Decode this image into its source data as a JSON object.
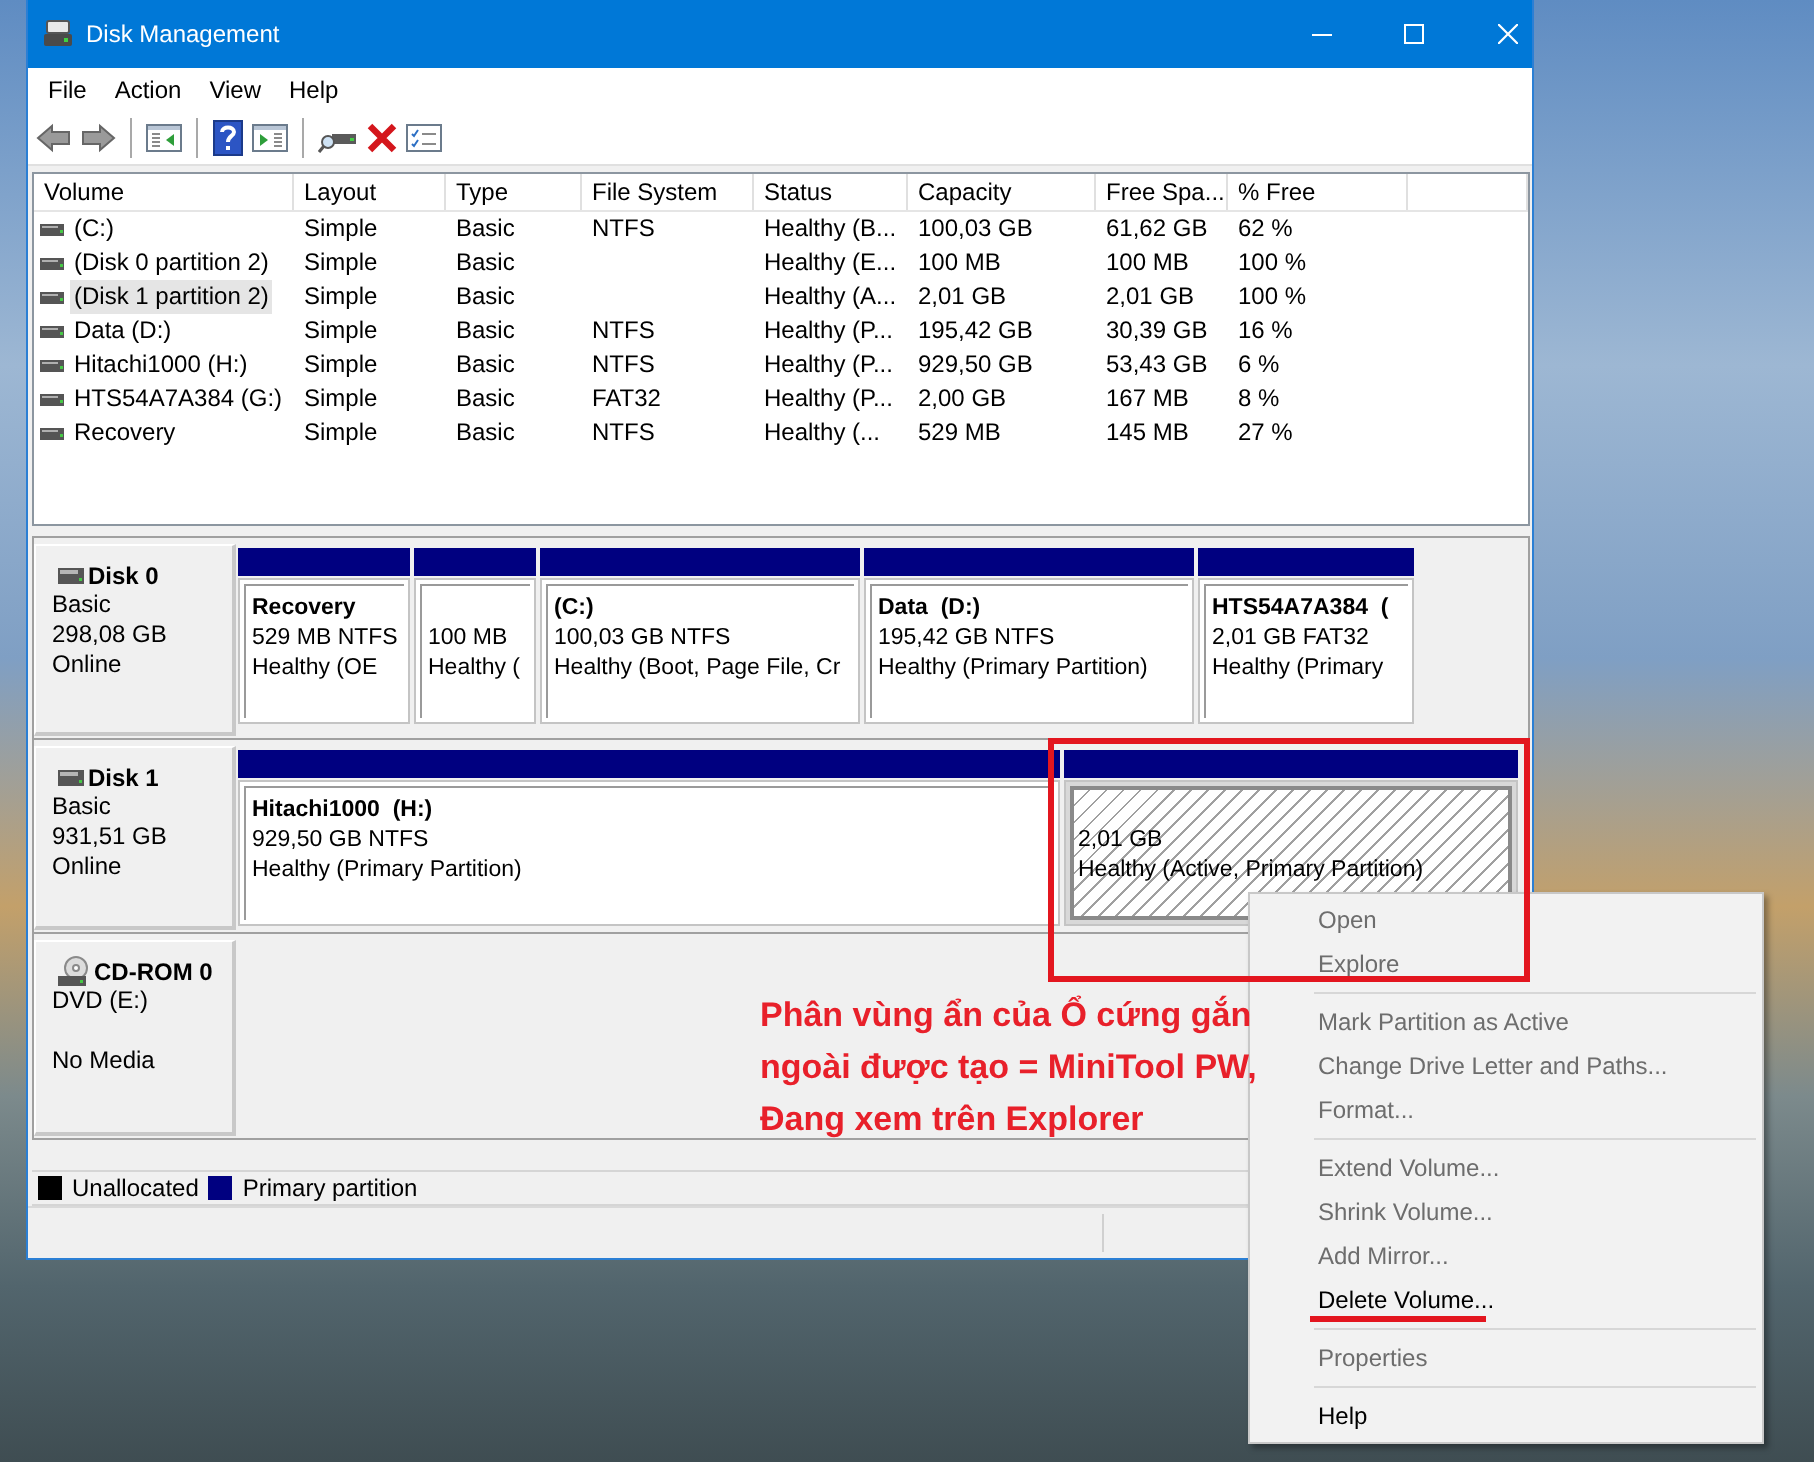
{
  "window": {
    "title": "Disk Management"
  },
  "menu_bar": [
    {
      "label": "File"
    },
    {
      "label": "Action"
    },
    {
      "label": "View"
    },
    {
      "label": "Help"
    }
  ],
  "volume_table": {
    "columns": [
      "Volume",
      "Layout",
      "Type",
      "File System",
      "Status",
      "Capacity",
      "Free Spa...",
      "% Free"
    ],
    "rows": [
      {
        "volume": "(C:)",
        "layout": "Simple",
        "type": "Basic",
        "file_system": "NTFS",
        "status": "Healthy (B...",
        "capacity": "100,03 GB",
        "free_space": "61,62 GB",
        "percent_free": "62 %",
        "selected": false
      },
      {
        "volume": "(Disk 0 partition 2)",
        "layout": "Simple",
        "type": "Basic",
        "status": "Healthy (E...",
        "capacity": "100 MB",
        "free_space": "100 MB",
        "percent_free": "100 %",
        "selected": false
      },
      {
        "volume": "(Disk 1 partition 2)",
        "layout": "Simple",
        "type": "Basic",
        "status": "Healthy (A...",
        "capacity": "2,01 GB",
        "free_space": "2,01 GB",
        "percent_free": "100 %",
        "selected": true
      },
      {
        "volume": "Data (D:)",
        "layout": "Simple",
        "type": "Basic",
        "file_system": "NTFS",
        "status": "Healthy (P...",
        "capacity": "195,42 GB",
        "free_space": "30,39 GB",
        "percent_free": "16 %",
        "selected": false
      },
      {
        "volume": "Hitachi1000 (H:)",
        "layout": "Simple",
        "type": "Basic",
        "file_system": "NTFS",
        "status": "Healthy (P...",
        "capacity": "929,50 GB",
        "free_space": "53,43 GB",
        "percent_free": "6 %",
        "selected": false
      },
      {
        "volume": "HTS54A7A384 (G:)",
        "layout": "Simple",
        "type": "Basic",
        "file_system": "FAT32",
        "status": "Healthy (P...",
        "capacity": "2,00 GB",
        "free_space": "167 MB",
        "percent_free": "8 %",
        "selected": false
      },
      {
        "volume": "Recovery",
        "layout": "Simple",
        "type": "Basic",
        "file_system": "NTFS",
        "status": "Healthy (...",
        "capacity": "529 MB",
        "free_space": "145 MB",
        "percent_free": "27 %",
        "selected": false
      }
    ]
  },
  "disks": [
    {
      "kind": "disk",
      "name": "Disk 0",
      "type": "Basic",
      "size": "298,08 GB",
      "status": "Online",
      "partitions": [
        {
          "name": "Recovery",
          "size": "529 MB NTFS",
          "status": "Healthy (OE",
          "selected": false,
          "marked": false
        },
        {
          "size": "100 MB",
          "status": "Healthy (",
          "selected": false,
          "marked": false
        },
        {
          "name": "(C:)",
          "size": "100,03 GB NTFS",
          "status": "Healthy (Boot, Page File, Cr",
          "selected": false,
          "marked": false
        },
        {
          "name": "Data  (D:)",
          "size": "195,42 GB NTFS",
          "status": "Healthy (Primary Partition)",
          "selected": false,
          "marked": false
        },
        {
          "name": "HTS54A7A384  (",
          "size": "2,01 GB FAT32",
          "status": "Healthy (Primary",
          "selected": false,
          "marked": false
        }
      ]
    },
    {
      "kind": "disk",
      "name": "Disk 1",
      "type": "Basic",
      "size": "931,51 GB",
      "status": "Online",
      "partitions": [
        {
          "name": "Hitachi1000  (H:)",
          "size": "929,50 GB NTFS",
          "status": "Healthy (Primary Partition)",
          "selected": false,
          "marked": false
        },
        {
          "size": "2,01 GB",
          "status": "Healthy (Active, Primary Partition)",
          "selected": true,
          "marked": true
        }
      ]
    },
    {
      "kind": "cdrom",
      "name": "CD-ROM 0",
      "type": "DVD (E:)",
      "status": "No Media"
    }
  ],
  "legend": [
    {
      "label": "Unallocated",
      "color": "#000000"
    },
    {
      "label": "Primary partition",
      "color": "#000080"
    }
  ],
  "context_menu": {
    "groups": [
      {
        "items": [
          {
            "label": "Open",
            "disabled": true,
            "marked": false
          },
          {
            "label": "Explore",
            "disabled": true,
            "marked": false
          }
        ]
      },
      {
        "items": [
          {
            "label": "Mark Partition as Active",
            "disabled": true,
            "marked": false
          },
          {
            "label": "Change Drive Letter and Paths...",
            "disabled": true,
            "marked": false
          },
          {
            "label": "Format...",
            "disabled": true,
            "marked": false
          }
        ]
      },
      {
        "items": [
          {
            "label": "Extend Volume...",
            "disabled": true,
            "marked": false
          },
          {
            "label": "Shrink Volume...",
            "disabled": true,
            "marked": false
          },
          {
            "label": "Add Mirror...",
            "disabled": true,
            "marked": false
          },
          {
            "label": "Delete Volume...",
            "disabled": false,
            "marked": true
          }
        ]
      },
      {
        "items": [
          {
            "label": "Properties",
            "disabled": true,
            "marked": false
          }
        ]
      },
      {
        "items": [
          {
            "label": "Help",
            "disabled": false,
            "marked": false
          }
        ]
      }
    ]
  },
  "annotation": {
    "text": "Phân vùng ẩn của Ổ cứng gắn\nngoài được tạo = MiniTool PW,\nĐang xem trên Explorer"
  }
}
